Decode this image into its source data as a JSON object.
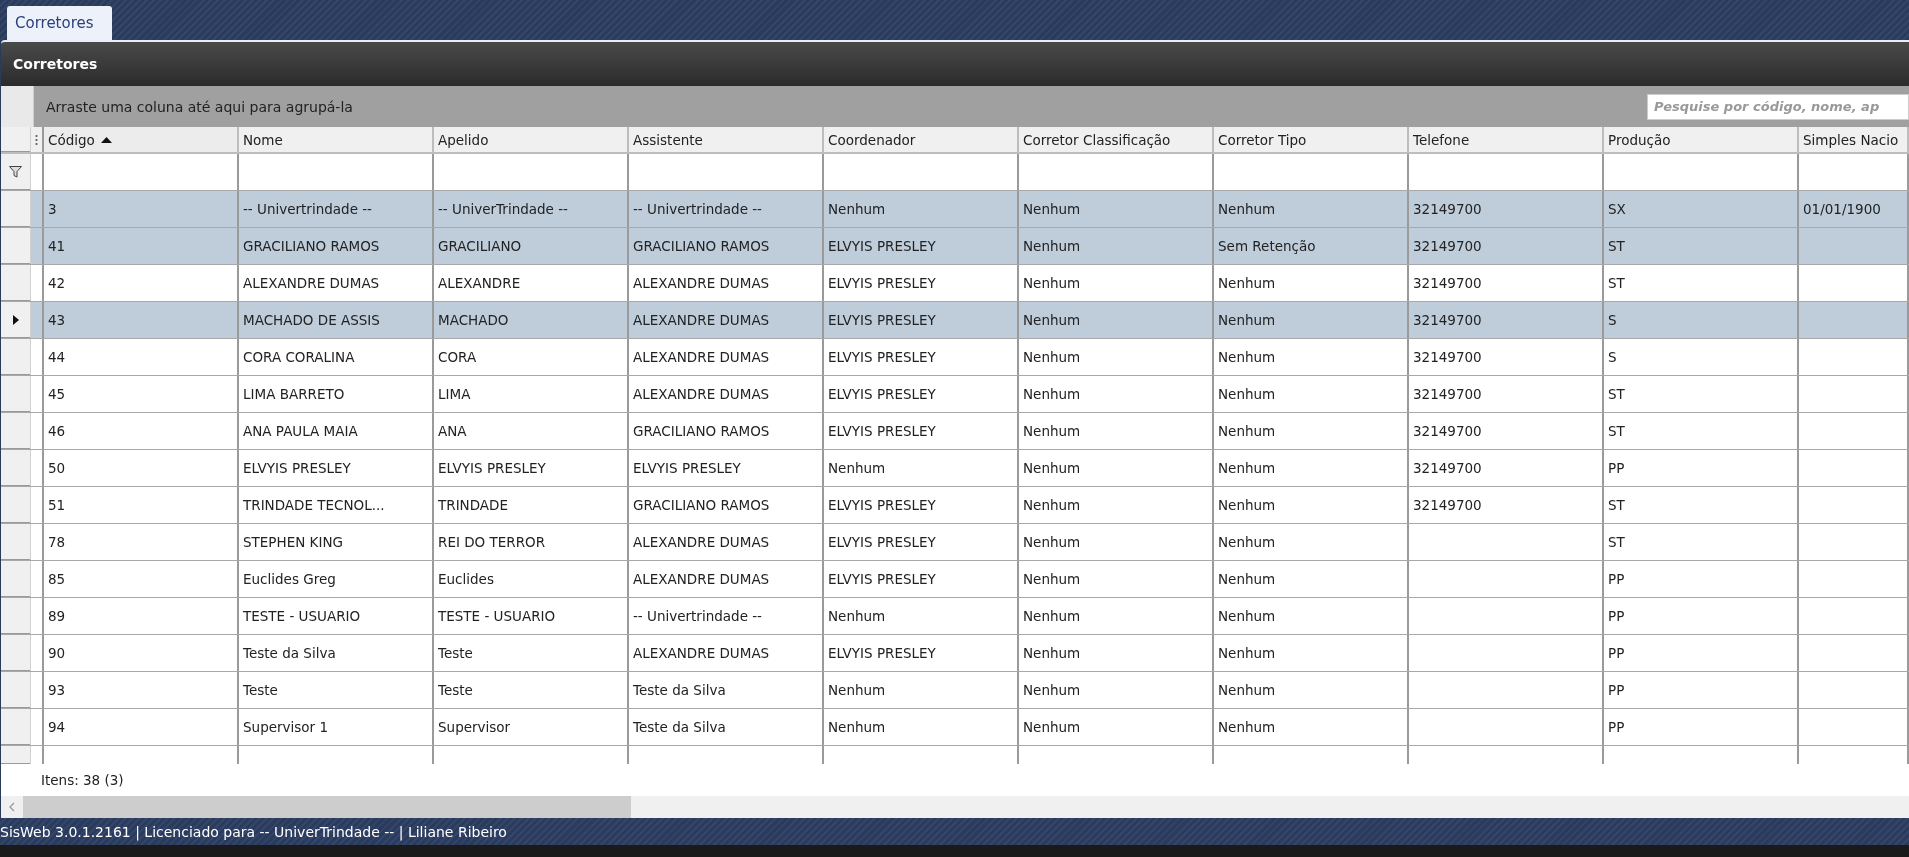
{
  "tab": {
    "label": "Corretores",
    "selected": true
  },
  "window": {
    "title": "Corretores"
  },
  "group_panel": {
    "hint": "Arraste uma coluna até aqui para agrupá-la"
  },
  "search": {
    "placeholder": "Pesquise por código, nome, ap"
  },
  "table": {
    "columns": [
      {
        "label": "Código",
        "sorted_ascending": true
      },
      {
        "label": "Nome"
      },
      {
        "label": "Apelido"
      },
      {
        "label": "Assistente"
      },
      {
        "label": "Coordenador"
      },
      {
        "label": "Corretor Classificação"
      },
      {
        "label": "Corretor Tipo"
      },
      {
        "label": "Telefone"
      },
      {
        "label": "Produção"
      },
      {
        "label": "Simples Nacio"
      }
    ],
    "rows": [
      {
        "cells": [
          "3",
          "-- Univertrindade --",
          "-- UniverTrindade --",
          "-- Univertrindade --",
          "Nenhum",
          "Nenhum",
          "Nenhum",
          "32149700",
          "SX",
          "01/01/1900"
        ],
        "selected": true,
        "current": false
      },
      {
        "cells": [
          "41",
          "GRACILIANO RAMOS",
          "GRACILIANO",
          "GRACILIANO RAMOS",
          "ELVYIS PRESLEY",
          "Nenhum",
          "Sem Retenção",
          "32149700",
          "ST",
          null
        ],
        "selected": true,
        "current": false
      },
      {
        "cells": [
          "42",
          "ALEXANDRE DUMAS",
          "ALEXANDRE",
          "ALEXANDRE DUMAS",
          "ELVYIS PRESLEY",
          "Nenhum",
          "Nenhum",
          "32149700",
          "ST",
          null
        ],
        "selected": false,
        "current": false
      },
      {
        "cells": [
          "43",
          "MACHADO DE ASSIS",
          "MACHADO",
          "ALEXANDRE DUMAS",
          "ELVYIS PRESLEY",
          "Nenhum",
          "Nenhum",
          "32149700",
          "S",
          null
        ],
        "selected": true,
        "current": true
      },
      {
        "cells": [
          "44",
          "CORA CORALINA",
          "CORA",
          "ALEXANDRE DUMAS",
          "ELVYIS PRESLEY",
          "Nenhum",
          "Nenhum",
          "32149700",
          "S",
          null
        ],
        "selected": false,
        "current": false
      },
      {
        "cells": [
          "45",
          "LIMA BARRETO",
          "LIMA",
          "ALEXANDRE DUMAS",
          "ELVYIS PRESLEY",
          "Nenhum",
          "Nenhum",
          "32149700",
          "ST",
          null
        ],
        "selected": false,
        "current": false
      },
      {
        "cells": [
          "46",
          "ANA PAULA MAIA",
          "ANA",
          "GRACILIANO RAMOS",
          "ELVYIS PRESLEY",
          "Nenhum",
          "Nenhum",
          "32149700",
          "ST",
          null
        ],
        "selected": false,
        "current": false
      },
      {
        "cells": [
          "50",
          "ELVYIS PRESLEY",
          "ELVYIS PRESLEY",
          "ELVYIS PRESLEY",
          "Nenhum",
          "Nenhum",
          "Nenhum",
          "32149700",
          "PP",
          null
        ],
        "selected": false,
        "current": false
      },
      {
        "cells": [
          "51",
          "TRINDADE TECNOL...",
          "TRINDADE",
          "GRACILIANO RAMOS",
          "ELVYIS PRESLEY",
          "Nenhum",
          "Nenhum",
          "32149700",
          "ST",
          null
        ],
        "selected": false,
        "current": false
      },
      {
        "cells": [
          "78",
          "STEPHEN KING",
          "REI DO TERROR",
          "ALEXANDRE DUMAS",
          "ELVYIS PRESLEY",
          "Nenhum",
          "Nenhum",
          null,
          "ST",
          null
        ],
        "selected": false,
        "current": false
      },
      {
        "cells": [
          "85",
          "Euclides Greg",
          "Euclides",
          "ALEXANDRE DUMAS",
          "ELVYIS PRESLEY",
          "Nenhum",
          "Nenhum",
          null,
          "PP",
          null
        ],
        "selected": false,
        "current": false
      },
      {
        "cells": [
          "89",
          "TESTE - USUARIO",
          "TESTE - USUARIO",
          "-- Univertrindade --",
          "Nenhum",
          "Nenhum",
          "Nenhum",
          null,
          "PP",
          null
        ],
        "selected": false,
        "current": false
      },
      {
        "cells": [
          "90",
          "Teste da Silva",
          "Teste",
          "ALEXANDRE DUMAS",
          "ELVYIS PRESLEY",
          "Nenhum",
          "Nenhum",
          null,
          "PP",
          null
        ],
        "selected": false,
        "current": false
      },
      {
        "cells": [
          "93",
          "Teste",
          "Teste",
          "Teste da Silva",
          "Nenhum",
          "Nenhum",
          "Nenhum",
          null,
          "PP",
          null
        ],
        "selected": false,
        "current": false
      },
      {
        "cells": [
          "94",
          "Supervisor 1",
          "Supervisor",
          "Teste da Silva",
          "Nenhum",
          "Nenhum",
          "Nenhum",
          null,
          "PP",
          null
        ],
        "selected": false,
        "current": false
      }
    ]
  },
  "footer": {
    "count": "Itens: 38 (3)"
  },
  "status_bar": {
    "text": "SisWeb 3.0.1.2161 | Licenciado para -- UniverTrindade -- | Liliane Ribeiro"
  }
}
